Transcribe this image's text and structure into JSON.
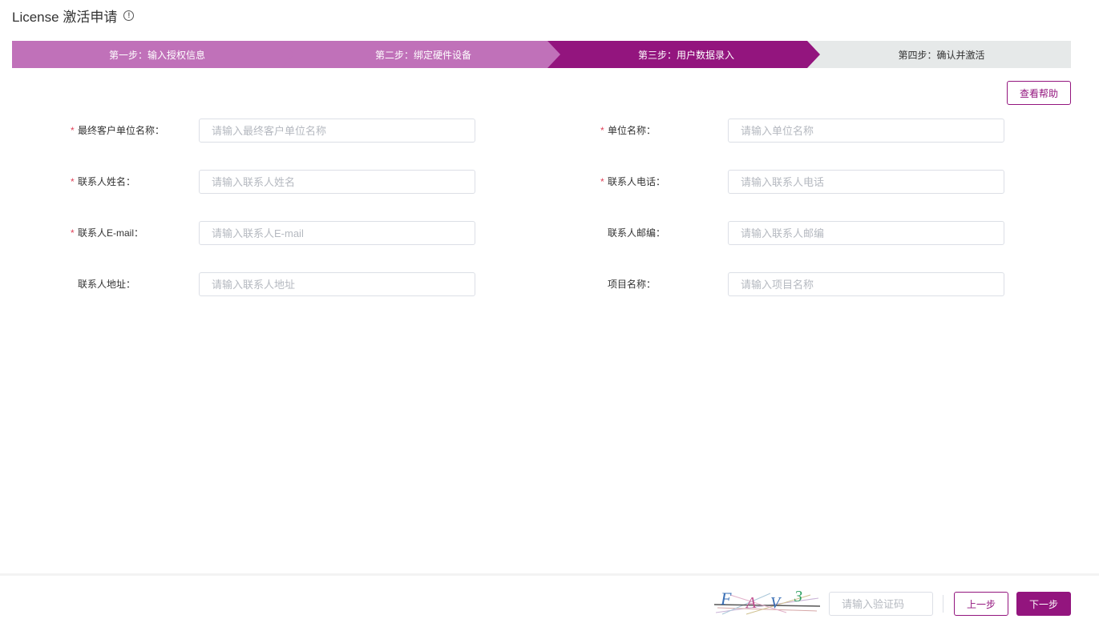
{
  "header": {
    "title": "License 激活申请",
    "info_icon": "info-circle-icon"
  },
  "steps": [
    {
      "label": "第一步：输入授权信息",
      "state": "done"
    },
    {
      "label": "第二步：绑定硬件设备",
      "state": "done"
    },
    {
      "label": "第三步：用户数据录入",
      "state": "active"
    },
    {
      "label": "第四步：确认并激活",
      "state": "pending"
    }
  ],
  "help_button": "查看帮助",
  "form": {
    "end_customer": {
      "label": "最终客户单位名称：",
      "placeholder": "请输入最终客户单位名称",
      "required": true
    },
    "company": {
      "label": "单位名称：",
      "placeholder": "请输入单位名称",
      "required": true
    },
    "contact_name": {
      "label": "联系人姓名：",
      "placeholder": "请输入联系人姓名",
      "required": true
    },
    "contact_phone": {
      "label": "联系人电话：",
      "placeholder": "请输入联系人电话",
      "required": true
    },
    "contact_email": {
      "label": "联系人E-mail：",
      "placeholder": "请输入联系人E-mail",
      "required": true
    },
    "contact_zip": {
      "label": "联系人邮编：",
      "placeholder": "请输入联系人邮编",
      "required": false
    },
    "contact_address": {
      "label": "联系人地址：",
      "placeholder": "请输入联系人地址",
      "required": false
    },
    "project_name": {
      "label": "项目名称：",
      "placeholder": "请输入项目名称",
      "required": false
    }
  },
  "required_mark": "*",
  "footer": {
    "captcha_text": "FAV3",
    "captcha_placeholder": "请输入验证码",
    "prev_label": "上一步",
    "next_label": "下一步"
  },
  "colors": {
    "primary": "#93157e",
    "step_done": "#c071b9",
    "step_pending": "#e6e9e9",
    "required": "#e0435a"
  }
}
